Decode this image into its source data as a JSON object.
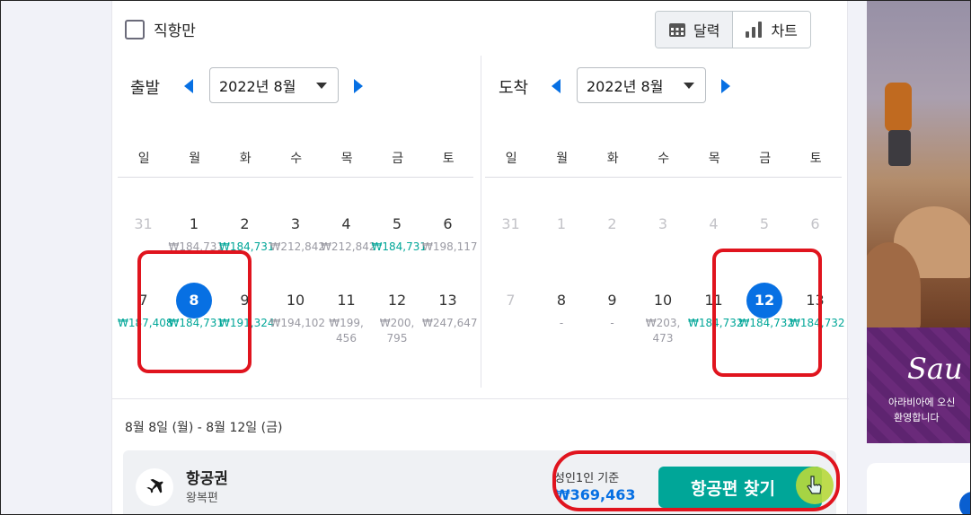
{
  "filter": {
    "direct_label": "직항만",
    "direct_checked": false
  },
  "view_toggle": {
    "calendar_label": "달력",
    "chart_label": "차트",
    "active": "calendar"
  },
  "depart": {
    "title": "출발",
    "month": "2022년 8월",
    "weekdays": [
      "일",
      "월",
      "화",
      "수",
      "목",
      "금",
      "토"
    ],
    "week1": [
      {
        "num": "31",
        "price": "",
        "muted": true
      },
      {
        "num": "1",
        "price": "₩184,731",
        "style": "grey"
      },
      {
        "num": "2",
        "price": "₩184,731",
        "style": "green"
      },
      {
        "num": "3",
        "price": "₩212,842",
        "style": "grey"
      },
      {
        "num": "4",
        "price": "₩212,842",
        "style": "grey"
      },
      {
        "num": "5",
        "price": "₩184,731",
        "style": "green"
      },
      {
        "num": "6",
        "price": "₩198,117",
        "style": "grey"
      }
    ],
    "week2": [
      {
        "num": "7",
        "price": "₩187,408",
        "style": "green"
      },
      {
        "num": "8",
        "price": "₩184,731",
        "style": "green",
        "selected": true
      },
      {
        "num": "9",
        "price": "₩191,324",
        "style": "green"
      },
      {
        "num": "10",
        "price": "₩194,102",
        "style": "grey"
      },
      {
        "num": "11",
        "price": "₩199,\n456",
        "style": "grey"
      },
      {
        "num": "12",
        "price": "₩200,\n795",
        "style": "grey"
      },
      {
        "num": "13",
        "price": "₩247,647",
        "style": "grey"
      }
    ]
  },
  "arrive": {
    "title": "도착",
    "month": "2022년 8월",
    "weekdays": [
      "일",
      "월",
      "화",
      "수",
      "목",
      "금",
      "토"
    ],
    "week1": [
      {
        "num": "31",
        "price": "",
        "muted": true
      },
      {
        "num": "1",
        "price": "",
        "muted": true
      },
      {
        "num": "2",
        "price": "",
        "muted": true
      },
      {
        "num": "3",
        "price": "",
        "muted": true
      },
      {
        "num": "4",
        "price": "",
        "muted": true
      },
      {
        "num": "5",
        "price": "",
        "muted": true
      },
      {
        "num": "6",
        "price": "",
        "muted": true
      }
    ],
    "week2": [
      {
        "num": "7",
        "price": "",
        "muted": true
      },
      {
        "num": "8",
        "price": "-",
        "style": "grey"
      },
      {
        "num": "9",
        "price": "-",
        "style": "grey"
      },
      {
        "num": "10",
        "price": "₩203,\n473",
        "style": "grey"
      },
      {
        "num": "11",
        "price": "₩184,732",
        "style": "green"
      },
      {
        "num": "12",
        "price": "₩184,732",
        "style": "green",
        "selected": true
      },
      {
        "num": "13",
        "price": "₩184,732",
        "style": "green"
      }
    ]
  },
  "summary": {
    "date_range": "8월 8일 (월) - 8월 12일 (금)",
    "card_title": "항공권",
    "card_subtitle": "왕복편",
    "basis": "성인1인 기준",
    "price": "₩369,463",
    "search_label": "항공편 찾기"
  },
  "ad": {
    "script": "Sau",
    "line1": "아라비아에 오신",
    "line2": "환영합니다"
  },
  "colors": {
    "accent": "#0770e3",
    "green": "#00a698",
    "highlight": "#e0141e"
  }
}
